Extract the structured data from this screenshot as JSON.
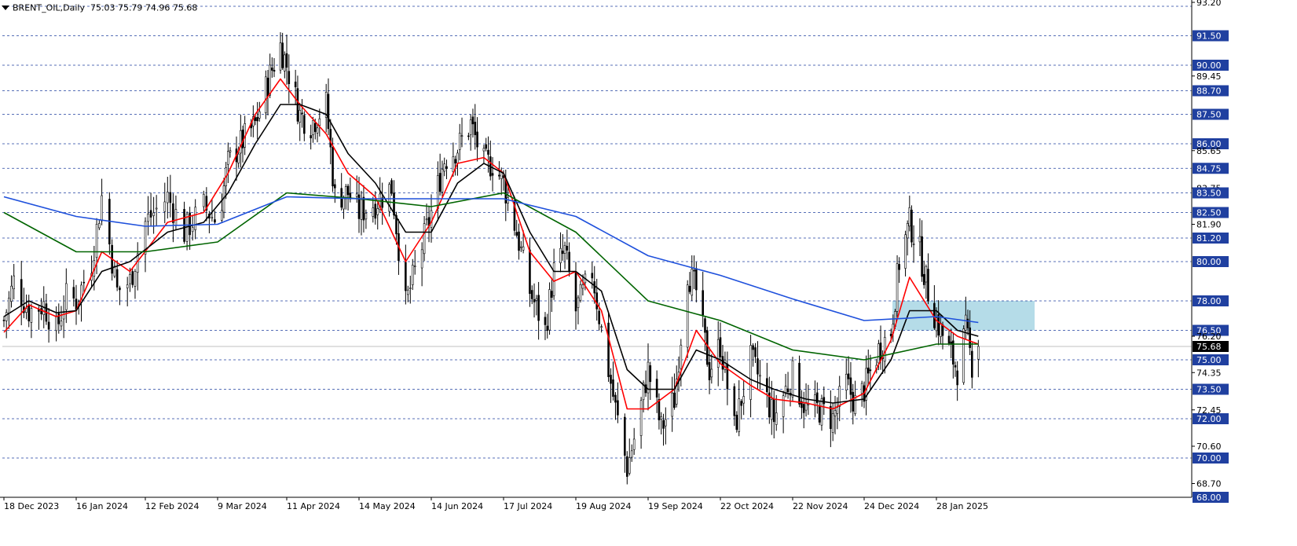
{
  "header": {
    "symbol": "BRENT_OIL,Daily",
    "ohlc": "75.03 75.79 74.96 75.68"
  },
  "chart_data": {
    "type": "candlestick",
    "symbol": "BRENT_OIL",
    "timeframe": "Daily",
    "open": 75.03,
    "high": 75.79,
    "low": 74.96,
    "close": 75.68,
    "current_price": 75.68,
    "ylim": [
      68.0,
      93.2
    ],
    "y_ticks": [
      93.2,
      91.5,
      90.0,
      89.45,
      88.7,
      87.5,
      86.0,
      85.65,
      84.75,
      83.75,
      83.5,
      82.5,
      81.9,
      81.2,
      80.0,
      78.0,
      76.5,
      76.2,
      75.68,
      75.0,
      74.35,
      73.5,
      72.45,
      72.0,
      70.6,
      70.0,
      68.7,
      68.0
    ],
    "y_tick_labels": [
      "93.20",
      "91.50",
      "90.00",
      "89.45",
      "88.70",
      "87.50",
      "86.00",
      "85.65",
      "84.75",
      "83.75",
      "83.50",
      "82.50",
      "81.90",
      "81.20",
      "80.00",
      "78.00",
      "76.50",
      "76.20",
      "75.68",
      "75.00",
      "74.35",
      "73.50",
      "72.45",
      "72.00",
      "70.60",
      "70.00",
      "68.70",
      "68.00"
    ],
    "boxed_levels": [
      93.0,
      91.5,
      90.0,
      88.7,
      87.5,
      86.0,
      84.75,
      83.5,
      82.5,
      81.2,
      80.0,
      78.0,
      76.5,
      75.0,
      73.5,
      72.0,
      70.0,
      68.0
    ],
    "horizontal_lines": [
      93.0,
      91.5,
      90.0,
      88.7,
      87.5,
      86.0,
      84.75,
      83.5,
      82.5,
      81.2,
      80.0,
      78.0,
      76.5,
      75.0,
      73.5,
      72.0,
      70.0
    ],
    "x_labels": [
      "18 Dec 2023",
      "16 Jan 2024",
      "12 Feb 2024",
      "9 Mar 2024",
      "11 Apr 2024",
      "14 May 2024",
      "14 Jun 2024",
      "17 Jul 2024",
      "19 Aug 2024",
      "19 Sep 2024",
      "22 Oct 2024",
      "22 Nov 2024",
      "24 Dec 2024",
      "28 Jan 2025"
    ],
    "zone": {
      "from": 76.5,
      "to": 78.0,
      "start_label": "24 Dec 2024",
      "color": "#add8e6"
    },
    "price_anchors": [
      [
        "18 Dec 2023",
        77.0
      ],
      [
        "22 Dec 2023",
        79.0
      ],
      [
        "28 Dec 2023",
        77.5
      ],
      [
        "3 Jan 2024",
        77.8
      ],
      [
        "8 Jan 2024",
        76.5
      ],
      [
        "12 Jan 2024",
        78.2
      ],
      [
        "16 Jan 2024",
        78.0
      ],
      [
        "22 Jan 2024",
        80.0
      ],
      [
        "26 Jan 2024",
        83.3
      ],
      [
        "1 Feb 2024",
        78.5
      ],
      [
        "6 Feb 2024",
        79.0
      ],
      [
        "12 Feb 2024",
        82.0
      ],
      [
        "20 Feb 2024",
        83.3
      ],
      [
        "26 Feb 2024",
        81.5
      ],
      [
        "4 Mar 2024",
        82.8
      ],
      [
        "9 Mar 2024",
        82.0
      ],
      [
        "14 Mar 2024",
        85.0
      ],
      [
        "20 Mar 2024",
        86.0
      ],
      [
        "27 Mar 2024",
        87.0
      ],
      [
        "3 Apr 2024",
        89.5
      ],
      [
        "8 Apr 2024",
        91.0
      ],
      [
        "11 Apr 2024",
        90.0
      ],
      [
        "17 Apr 2024",
        87.5
      ],
      [
        "22 Apr 2024",
        87.0
      ],
      [
        "29 Apr 2024",
        88.0
      ],
      [
        "3 May 2024",
        83.3
      ],
      [
        "9 May 2024",
        83.5
      ],
      [
        "14 May 2024",
        82.5
      ],
      [
        "21 May 2024",
        83.0
      ],
      [
        "28 May 2024",
        83.8
      ],
      [
        "3 Jun 2024",
        77.8
      ],
      [
        "7 Jun 2024",
        79.5
      ],
      [
        "14 Jun 2024",
        82.5
      ],
      [
        "20 Jun 2024",
        85.2
      ],
      [
        "26 Jun 2024",
        85.8
      ],
      [
        "2 Jul 2024",
        87.0
      ],
      [
        "8 Jul 2024",
        85.0
      ],
      [
        "12 Jul 2024",
        85.0
      ],
      [
        "17 Jul 2024",
        84.0
      ],
      [
        "23 Jul 2024",
        81.5
      ],
      [
        "29 Jul 2024",
        78.5
      ],
      [
        "5 Aug 2024",
        76.5
      ],
      [
        "9 Aug 2024",
        79.5
      ],
      [
        "14 Aug 2024",
        80.5
      ],
      [
        "19 Aug 2024",
        77.5
      ],
      [
        "26 Aug 2024",
        79.5
      ],
      [
        "30 Aug 2024",
        76.5
      ],
      [
        "5 Sep 2024",
        72.5
      ],
      [
        "10 Sep 2024",
        69.5
      ],
      [
        "14 Sep 2024",
        71.5
      ],
      [
        "19 Sep 2024",
        74.5
      ],
      [
        "25 Sep 2024",
        71.5
      ],
      [
        "1 Oct 2024",
        73.0
      ],
      [
        "7 Oct 2024",
        79.5
      ],
      [
        "11 Oct 2024",
        78.5
      ],
      [
        "17 Oct 2024",
        74.5
      ],
      [
        "22 Oct 2024",
        75.8
      ],
      [
        "28 Oct 2024",
        71.5
      ],
      [
        "4 Nov 2024",
        75.0
      ],
      [
        "8 Nov 2024",
        74.0
      ],
      [
        "14 Nov 2024",
        72.0
      ],
      [
        "19 Nov 2024",
        73.5
      ],
      [
        "22 Nov 2024",
        74.2
      ],
      [
        "28 Nov 2024",
        72.5
      ],
      [
        "4 Dec 2024",
        72.5
      ],
      [
        "10 Dec 2024",
        72.0
      ],
      [
        "16 Dec 2024",
        73.8
      ],
      [
        "20 Dec 2024",
        72.8
      ],
      [
        "24 Dec 2024",
        73.5
      ],
      [
        "31 Dec 2024",
        75.5
      ],
      [
        "6 Jan 2025",
        76.5
      ],
      [
        "10 Jan 2025",
        80.0
      ],
      [
        "15 Jan 2025",
        82.0
      ],
      [
        "20 Jan 2025",
        80.5
      ],
      [
        "24 Jan 2025",
        78.5
      ],
      [
        "28 Jan 2025",
        77.0
      ],
      [
        "3 Feb 2025",
        75.5
      ],
      [
        "7 Feb 2025",
        74.5
      ],
      [
        "11 Feb 2025",
        76.5
      ],
      [
        "14 Feb 2025",
        74.8
      ],
      [
        "17 Feb 2025",
        75.7
      ]
    ],
    "moving_averages": [
      {
        "color": "#ff0000",
        "points": [
          [
            "18 Dec 2023",
            76.4
          ],
          [
            "28 Dec 2023",
            77.8
          ],
          [
            "8 Jan 2024",
            77.2
          ],
          [
            "16 Jan 2024",
            77.5
          ],
          [
            "26 Jan 2024",
            80.5
          ],
          [
            "6 Feb 2024",
            79.5
          ],
          [
            "20 Feb 2024",
            82.0
          ],
          [
            "4 Mar 2024",
            82.5
          ],
          [
            "14 Mar 2024",
            84.5
          ],
          [
            "27 Mar 2024",
            87.5
          ],
          [
            "8 Apr 2024",
            89.3
          ],
          [
            "17 Apr 2024",
            88.0
          ],
          [
            "29 Apr 2024",
            86.5
          ],
          [
            "9 May 2024",
            84.5
          ],
          [
            "21 May 2024",
            83.3
          ],
          [
            "3 Jun 2024",
            80.0
          ],
          [
            "14 Jun 2024",
            82.0
          ],
          [
            "26 Jun 2024",
            85.0
          ],
          [
            "8 Jul 2024",
            85.3
          ],
          [
            "17 Jul 2024",
            84.5
          ],
          [
            "29 Jul 2024",
            80.5
          ],
          [
            "9 Aug 2024",
            79.0
          ],
          [
            "19 Aug 2024",
            79.5
          ],
          [
            "30 Aug 2024",
            77.5
          ],
          [
            "10 Sep 2024",
            72.5
          ],
          [
            "19 Sep 2024",
            72.5
          ],
          [
            "1 Oct 2024",
            73.5
          ],
          [
            "11 Oct 2024",
            76.5
          ],
          [
            "22 Oct 2024",
            74.8
          ],
          [
            "4 Nov 2024",
            73.7
          ],
          [
            "14 Nov 2024",
            73.0
          ],
          [
            "28 Nov 2024",
            72.8
          ],
          [
            "10 Dec 2024",
            72.5
          ],
          [
            "24 Dec 2024",
            73.3
          ],
          [
            "6 Jan 2025",
            76.0
          ],
          [
            "15 Jan 2025",
            79.2
          ],
          [
            "28 Jan 2025",
            77.0
          ],
          [
            "7 Feb 2025",
            76.2
          ],
          [
            "17 Feb 2025",
            75.8
          ]
        ]
      },
      {
        "color": "#000000",
        "points": [
          [
            "18 Dec 2023",
            77.2
          ],
          [
            "28 Dec 2023",
            78.0
          ],
          [
            "8 Jan 2024",
            77.4
          ],
          [
            "16 Jan 2024",
            77.5
          ],
          [
            "26 Jan 2024",
            79.5
          ],
          [
            "6 Feb 2024",
            80.0
          ],
          [
            "20 Feb 2024",
            81.5
          ],
          [
            "4 Mar 2024",
            82.0
          ],
          [
            "14 Mar 2024",
            83.5
          ],
          [
            "27 Mar 2024",
            86.0
          ],
          [
            "8 Apr 2024",
            88.0
          ],
          [
            "17 Apr 2024",
            88.0
          ],
          [
            "29 Apr 2024",
            87.5
          ],
          [
            "9 May 2024",
            85.5
          ],
          [
            "21 May 2024",
            84.0
          ],
          [
            "3 Jun 2024",
            81.5
          ],
          [
            "14 Jun 2024",
            81.5
          ],
          [
            "26 Jun 2024",
            84.0
          ],
          [
            "8 Jul 2024",
            85.0
          ],
          [
            "17 Jul 2024",
            84.5
          ],
          [
            "29 Jul 2024",
            81.5
          ],
          [
            "9 Aug 2024",
            79.5
          ],
          [
            "19 Aug 2024",
            79.5
          ],
          [
            "30 Aug 2024",
            78.5
          ],
          [
            "10 Sep 2024",
            74.5
          ],
          [
            "19 Sep 2024",
            73.5
          ],
          [
            "1 Oct 2024",
            73.5
          ],
          [
            "11 Oct 2024",
            75.5
          ],
          [
            "22 Oct 2024",
            75.0
          ],
          [
            "4 Nov 2024",
            74.0
          ],
          [
            "14 Nov 2024",
            73.5
          ],
          [
            "28 Nov 2024",
            73.0
          ],
          [
            "10 Dec 2024",
            72.8
          ],
          [
            "24 Dec 2024",
            73.0
          ],
          [
            "6 Jan 2025",
            75.0
          ],
          [
            "15 Jan 2025",
            77.5
          ],
          [
            "28 Jan 2025",
            77.5
          ],
          [
            "7 Feb 2025",
            76.5
          ],
          [
            "17 Feb 2025",
            76.2
          ]
        ]
      },
      {
        "color": "#006400",
        "points": [
          [
            "18 Dec 2023",
            82.5
          ],
          [
            "16 Jan 2024",
            80.5
          ],
          [
            "12 Feb 2024",
            80.5
          ],
          [
            "9 Mar 2024",
            81.0
          ],
          [
            "11 Apr 2024",
            83.5
          ],
          [
            "14 May 2024",
            83.2
          ],
          [
            "14 Jun 2024",
            82.8
          ],
          [
            "17 Jul 2024",
            83.5
          ],
          [
            "19 Aug 2024",
            81.5
          ],
          [
            "19 Sep 2024",
            78.0
          ],
          [
            "22 Oct 2024",
            77.0
          ],
          [
            "22 Nov 2024",
            75.5
          ],
          [
            "24 Dec 2024",
            75.0
          ],
          [
            "28 Jan 2025",
            75.8
          ],
          [
            "17 Feb 2025",
            75.8
          ]
        ]
      },
      {
        "color": "#1e50dc",
        "points": [
          [
            "18 Dec 2023",
            83.3
          ],
          [
            "16 Jan 2024",
            82.3
          ],
          [
            "12 Feb 2024",
            81.8
          ],
          [
            "9 Mar 2024",
            81.9
          ],
          [
            "11 Apr 2024",
            83.3
          ],
          [
            "14 May 2024",
            83.2
          ],
          [
            "14 Jun 2024",
            83.2
          ],
          [
            "17 Jul 2024",
            83.2
          ],
          [
            "19 Aug 2024",
            82.3
          ],
          [
            "19 Sep 2024",
            80.3
          ],
          [
            "22 Oct 2024",
            79.3
          ],
          [
            "22 Nov 2024",
            78.1
          ],
          [
            "24 Dec 2024",
            77.0
          ],
          [
            "28 Jan 2025",
            77.2
          ],
          [
            "17 Feb 2025",
            76.9
          ]
        ]
      }
    ]
  }
}
